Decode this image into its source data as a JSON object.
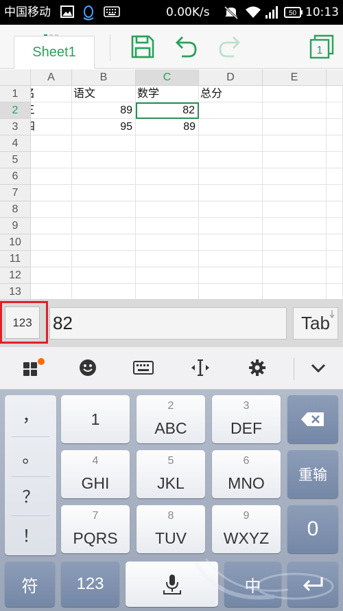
{
  "status_bar": {
    "carrier": "中国移动",
    "speed": "0.00K/s",
    "battery": "50",
    "time": "10:13",
    "icons": [
      "image-icon",
      "qq-icon",
      "keyboard-icon",
      "mute-icon",
      "wifi-icon",
      "signal-icon",
      "battery-icon"
    ]
  },
  "toolbar": {
    "sheet_tab": "Sheet1",
    "page_count": "1",
    "icons": [
      "save-icon",
      "undo-icon",
      "redo-icon",
      "pages-icon"
    ]
  },
  "spreadsheet": {
    "columns": [
      "A",
      "B",
      "C",
      "D",
      "E"
    ],
    "selected_column": "C",
    "rows": [
      "1",
      "2",
      "3",
      "4",
      "5",
      "6",
      "7",
      "8",
      "9",
      "10",
      "11",
      "12",
      "13"
    ],
    "selected_row": "2",
    "cells": {
      "A1": "名",
      "B1": "语文",
      "C1": "数学",
      "D1": "总分",
      "A2": "三",
      "B2": "89",
      "C2": "82",
      "A3": "四",
      "B3": "95",
      "C3": "89"
    },
    "active_cell": "C2"
  },
  "input_bar": {
    "mode_label": "123",
    "value": "82",
    "tab_label": "Tab"
  },
  "ime_toolbar": {
    "icons": [
      "grid-menu-icon",
      "emoji-icon",
      "keyboard-icon",
      "cursor-move-icon",
      "settings-icon",
      "collapse-icon"
    ]
  },
  "keyboard": {
    "punctuation": [
      "，",
      "。",
      "？",
      "！"
    ],
    "keys": [
      {
        "num": "",
        "label": "1"
      },
      {
        "num": "2",
        "label": "ABC"
      },
      {
        "num": "3",
        "label": "DEF"
      },
      {
        "num": "4",
        "label": "GHI"
      },
      {
        "num": "5",
        "label": "JKL"
      },
      {
        "num": "6",
        "label": "MNO"
      },
      {
        "num": "7",
        "label": "PQRS"
      },
      {
        "num": "8",
        "label": "TUV"
      },
      {
        "num": "9",
        "label": "WXYZ"
      }
    ],
    "reenter": "重输",
    "zero": "0",
    "symbols": "符",
    "num_mode": "123",
    "lang": "中"
  },
  "colors": {
    "accent_green": "#27a25b",
    "highlight_red": "#e0202a",
    "keyboard_blue": "#7487a6"
  }
}
